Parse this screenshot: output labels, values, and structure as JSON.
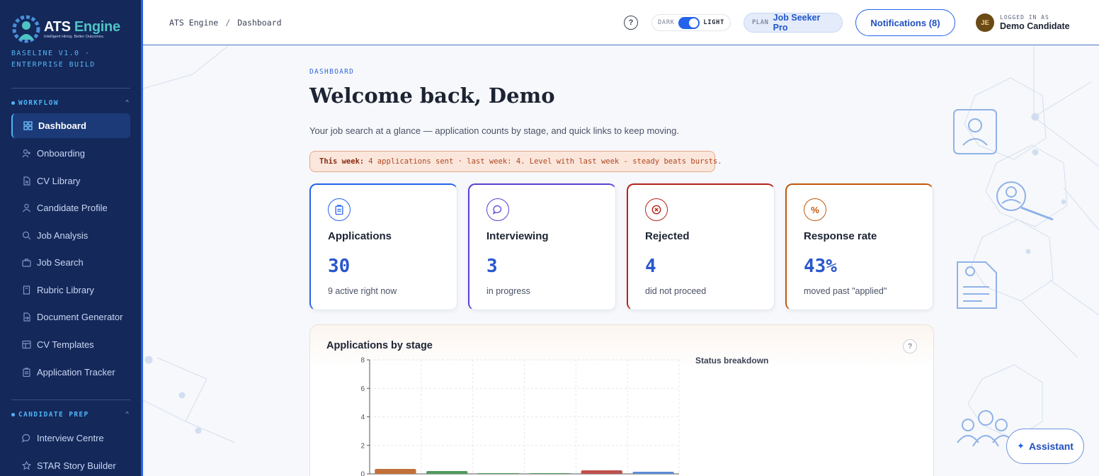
{
  "brand": {
    "name_part1": "ATS",
    "name_part2": "Engine",
    "tagline": "Intelligent Hiring. Better Outcomes.",
    "build": "BASELINE V1.0 · ENTERPRISE BUILD"
  },
  "sidebar": {
    "sections": [
      {
        "title": "WORKFLOW",
        "items": [
          {
            "label": "Dashboard",
            "icon": "grid-icon",
            "active": true
          },
          {
            "label": "Onboarding",
            "icon": "user-plus-icon"
          },
          {
            "label": "CV Library",
            "icon": "file-icon"
          },
          {
            "label": "Candidate Profile",
            "icon": "user-icon"
          },
          {
            "label": "Job Analysis",
            "icon": "search-icon"
          },
          {
            "label": "Job Search",
            "icon": "briefcase-icon"
          },
          {
            "label": "Rubric Library",
            "icon": "book-icon"
          },
          {
            "label": "Document Generator",
            "icon": "file-export-icon"
          },
          {
            "label": "CV Templates",
            "icon": "template-icon"
          },
          {
            "label": "Application Tracker",
            "icon": "clipboard-icon"
          }
        ]
      },
      {
        "title": "CANDIDATE PREP",
        "items": [
          {
            "label": "Interview Centre",
            "icon": "chat-icon"
          },
          {
            "label": "STAR Story Builder",
            "icon": "star-icon"
          }
        ]
      }
    ]
  },
  "header": {
    "breadcrumb": [
      "ATS Engine",
      "Dashboard"
    ],
    "breadcrumb_sep": "/",
    "help": "?",
    "theme_dark": "DARK",
    "theme_light": "LIGHT",
    "plan_label": "PLAN",
    "plan_value": "Job Seeker Pro",
    "notifications": "Notifications (8)",
    "user_initials": "JE",
    "user_caption": "LOGGED IN AS",
    "user_name": "Demo Candidate"
  },
  "main": {
    "eyebrow": "DASHBOARD",
    "title": "Welcome back, Demo",
    "lead": "Your job search at a glance — application counts by stage, and quick links to keep moving.",
    "week_label": "This week:",
    "week_text": "4 applications sent · last week: 4. Level with last week - steady beats bursts.",
    "cards": [
      {
        "title": "Applications",
        "value": "30",
        "sub": "9 active right now",
        "color": "#2563eb",
        "icon": "clipboard-icon"
      },
      {
        "title": "Interviewing",
        "value": "3",
        "sub": "in progress",
        "color": "#5b3fd6",
        "icon": "chat-icon"
      },
      {
        "title": "Rejected",
        "value": "4",
        "sub": "did not proceed",
        "color": "#b42318",
        "icon": "x-circle-icon"
      },
      {
        "title": "Response rate",
        "value": "43%",
        "sub": "moved past \"applied\"",
        "color": "#c2570c",
        "icon": "percent-icon"
      }
    ],
    "panel_title": "Applications by stage",
    "panel_help": "?",
    "breakdown_title": "Status breakdown"
  },
  "chart_data": {
    "type": "bar",
    "title": "Applications by stage",
    "ylim": [
      0,
      8
    ],
    "yticks": [
      "0",
      "2",
      "4",
      "6",
      "8"
    ],
    "values": [
      0.35,
      0.2,
      0.05,
      0.05,
      0.25,
      0.15
    ],
    "colors": [
      "#c2703a",
      "#4f9a5c",
      "#4f9a5c",
      "#4f9a5c",
      "#c0504d",
      "#5c8fd6"
    ],
    "grid": true
  },
  "assistant": {
    "label": "Assistant",
    "icon": "sparkle-icon"
  }
}
